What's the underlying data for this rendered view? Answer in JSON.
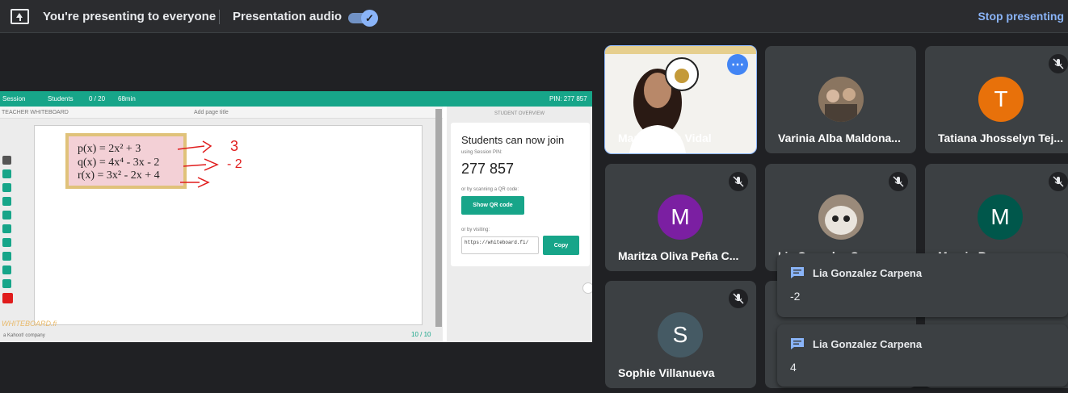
{
  "topbar": {
    "presenting_text": "You're presenting to everyone",
    "audio_label": "Presentation audio",
    "audio_on": true,
    "stop_label": "Stop presenting"
  },
  "presentation": {
    "top": {
      "session": "Session",
      "students": "Students",
      "count": "0 / 20",
      "time": "68min",
      "pin_label": "PIN: 277 857"
    },
    "sub": {
      "board_label": "TEACHER WHITEBOARD",
      "add_page_title": "Add page title",
      "student_overview": "STUDENT OVERVIEW"
    },
    "math": [
      "p(x) = 2x² + 3",
      "q(x) = 4x⁴ - 3x  - 2",
      "r(x) = 3x² - 2x + 4"
    ],
    "ink": [
      "3",
      "- 2"
    ],
    "brand": "WHITEBOARD.fi",
    "brand_sub": "a Kahoot! company",
    "page_count": "10 / 10",
    "card": {
      "heading": "Students can now join",
      "pin_caption": "using Session PIN:",
      "pin": "277 857",
      "qr_caption": "or by scanning a QR code:",
      "qr_button": "Show QR code",
      "visit_caption": "or by visiting:",
      "url": "https://whiteboard.fi/",
      "copy_button": "Copy"
    }
  },
  "participants": [
    {
      "name": "Maricarmen Vidal",
      "type": "video"
    },
    {
      "name": "Varinia Alba Maldona...",
      "type": "photo"
    },
    {
      "name": "Tatiana Jhosselyn Tej...",
      "type": "letter",
      "letter": "T",
      "color": "#e8710a"
    },
    {
      "name": "Maritza Oliva Peña C...",
      "type": "letter",
      "letter": "M",
      "color": "#7b1fa2"
    },
    {
      "name": "Lia Gonzalez Carpena",
      "type": "photo"
    },
    {
      "name": "Maurin Rapea",
      "type": "letter",
      "letter": "M",
      "color": "#00574b"
    },
    {
      "name": "Sophie Villanueva",
      "type": "letter",
      "letter": "S",
      "color": "#455a64"
    }
  ],
  "chats": [
    {
      "sender": "Lia Gonzalez Carpena",
      "message": "-2"
    },
    {
      "sender": "Lia Gonzalez Carpena",
      "message": "4"
    }
  ]
}
